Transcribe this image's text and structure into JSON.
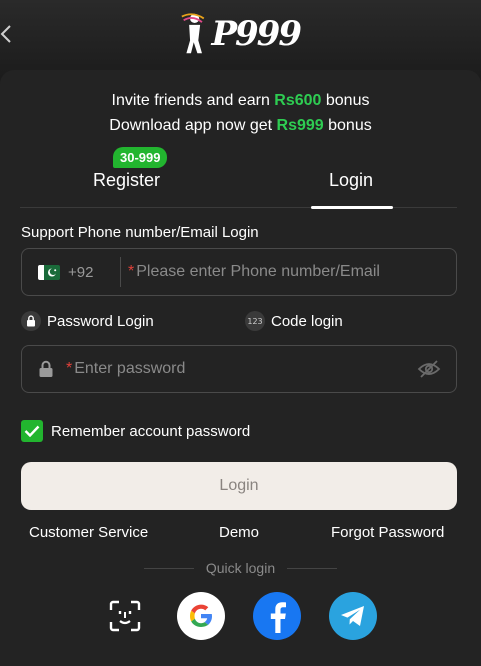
{
  "promo": {
    "line1_prefix": "Invite friends and earn ",
    "line1_amount": "Rs600",
    "line1_suffix": " bonus",
    "line2_prefix": "Download app now get ",
    "line2_amount": "Rs999",
    "line2_suffix": " bonus"
  },
  "brand": {
    "logo_text": "P999"
  },
  "tabs": {
    "register_label": "Register",
    "register_badge": "30-999",
    "login_label": "Login",
    "active": "login"
  },
  "form": {
    "support_label": "Support Phone number/Email Login",
    "country_code": "+92",
    "phone_required_mark": "*",
    "phone_placeholder": "Please enter Phone number/Email",
    "password_mode_label": "Password Login",
    "code_mode_label": "Code login",
    "code_icon_text": "123",
    "password_required_mark": "*",
    "password_placeholder": "Enter password",
    "remember_label": "Remember account password",
    "remember_checked": true,
    "login_button": "Login"
  },
  "links": {
    "customer_service": "Customer Service",
    "demo": "Demo",
    "forgot_password": "Forgot Password"
  },
  "quick_login": {
    "label": "Quick login",
    "providers": [
      "face-id",
      "google",
      "facebook",
      "telegram"
    ]
  },
  "icons": {
    "back": "chevron-left-icon",
    "lock": "lock-icon",
    "eye": "eye-off-icon",
    "check": "check-icon",
    "flag": "pakistan-flag-icon"
  },
  "colors": {
    "accent_green": "#22b52f",
    "highlight_green": "#2ecc52",
    "panel_bg": "#232323",
    "login_button_bg": "#f2ede8",
    "required_red": "#e0413a"
  }
}
